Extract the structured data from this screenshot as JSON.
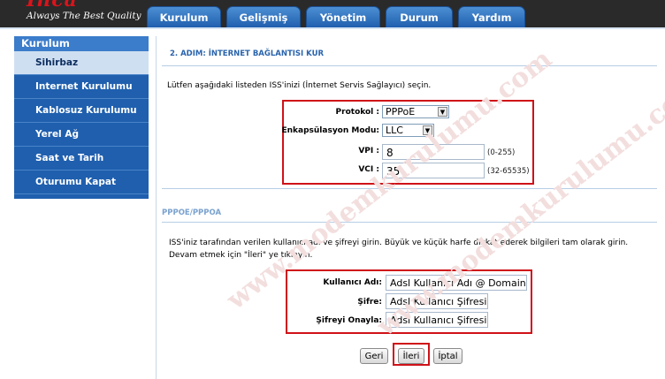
{
  "header": {
    "logo": "Inca",
    "tagline": "Always The Best Quality",
    "tabs": [
      {
        "label": "Kurulum"
      },
      {
        "label": "Gelişmiş"
      },
      {
        "label": "Yönetim"
      },
      {
        "label": "Durum"
      },
      {
        "label": "Yardım"
      }
    ]
  },
  "sidebar": {
    "title": "Kurulum",
    "active_index": 0,
    "items": [
      {
        "label": "Sihirbaz"
      },
      {
        "label": "Internet Kurulumu"
      },
      {
        "label": "Kablosuz Kurulumu"
      },
      {
        "label": "Yerel Ağ"
      },
      {
        "label": "Saat ve Tarih"
      },
      {
        "label": "Oturumu Kapat"
      }
    ]
  },
  "main": {
    "step_title": "2. ADIM: İNTERNET BAĞLANTISI KUR",
    "intro": "Lütfen aşağıdaki listeden ISS'inizi (İnternet Servis Sağlayıcı) seçin.",
    "protocol": {
      "label": "Protokol :",
      "value": "PPPoE"
    },
    "encapsulation": {
      "label": "Enkapsülasyon Modu:",
      "value": "LLC"
    },
    "vpi": {
      "label": "VPI :",
      "value": "8",
      "hint": "(0-255)"
    },
    "vci": {
      "label": "VCI :",
      "value": "35",
      "hint": "(32-65535)"
    },
    "pppoe": {
      "section_title": "PPPOE/PPPOA",
      "description": "ISS'iniz tarafından verilen kullanıcı adı ve şifreyi girin. Büyük ve küçük harfe dikkat ederek bilgileri tam olarak girin. Devam etmek için \"İleri\" ye tıklayın.",
      "username": {
        "label": "Kullanıcı Adı:",
        "value": "Adsl Kullanıcı Adı @ Domain"
      },
      "password": {
        "label": "Şifre:",
        "value": "Adsl Kullanıcı Şifresi"
      },
      "confirm": {
        "label": "Şifreyi Onayla:",
        "value": "Adsl Kullanıcı Şifresi"
      }
    },
    "buttons": {
      "back": "Geri",
      "next": "İleri",
      "cancel": "İptal"
    }
  },
  "watermark": "www.modemkurulumu.com",
  "colors": {
    "highlight_box": "#cf1218",
    "nav_blue": "#1f5fae",
    "header_bg": "#2a2a2a"
  }
}
